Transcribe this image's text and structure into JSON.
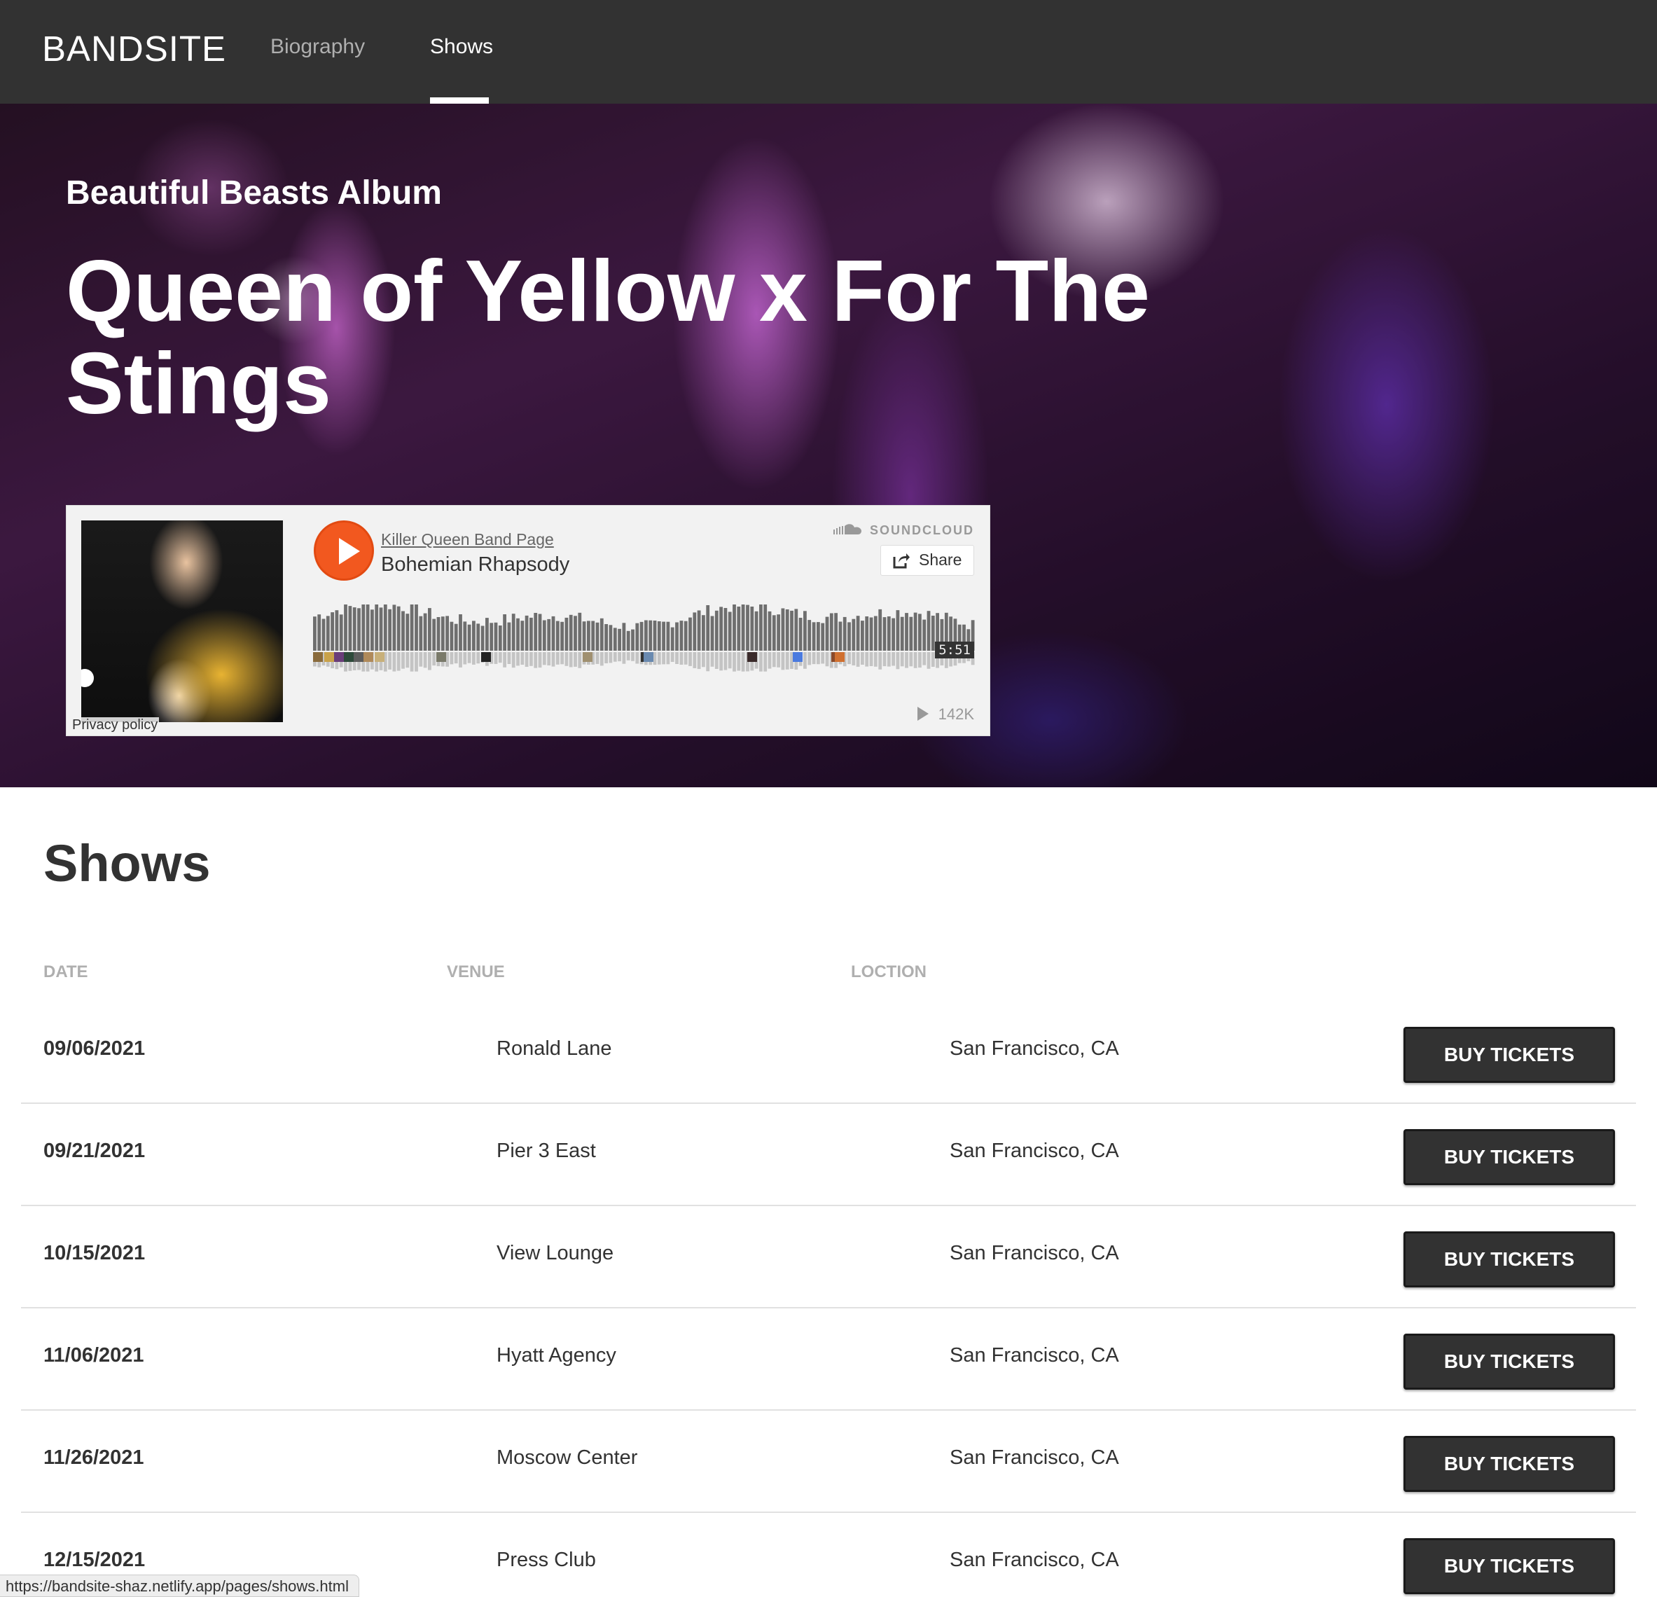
{
  "header": {
    "logo": "BANDSITE",
    "nav": [
      {
        "label": "Biography",
        "active": false
      },
      {
        "label": "Shows",
        "active": true
      }
    ]
  },
  "hero": {
    "subtitle": "Beautiful Beasts Album",
    "title": "Queen of Yellow x For The Stings"
  },
  "player": {
    "artist": "Killer Queen Band Page",
    "track": "Bohemian Rhapsody",
    "brand": "SOUNDCLOUD",
    "share_label": "Share",
    "duration": "5:51",
    "plays": "142K",
    "privacy": "Privacy policy",
    "accent_color": "#f2581f"
  },
  "shows": {
    "title": "Shows",
    "columns": {
      "date": "DATE",
      "venue": "VENUE",
      "location": "LOCTION"
    },
    "button_label": "BUY TICKETS",
    "rows": [
      {
        "date": "09/06/2021",
        "venue": "Ronald Lane",
        "location": "San Francisco, CA"
      },
      {
        "date": "09/21/2021",
        "venue": "Pier 3 East",
        "location": "San Francisco, CA"
      },
      {
        "date": "10/15/2021",
        "venue": "View Lounge",
        "location": "San Francisco, CA"
      },
      {
        "date": "11/06/2021",
        "venue": "Hyatt Agency",
        "location": "San Francisco, CA"
      },
      {
        "date": "11/26/2021",
        "venue": "Moscow Center",
        "location": "San Francisco, CA"
      },
      {
        "date": "12/15/2021",
        "venue": "Press Club",
        "location": "San Francisco, CA"
      }
    ]
  },
  "status_bar": {
    "url": "https://bandsite-shaz.netlify.app/pages/shows.html"
  },
  "icons": [
    "soundcloud-logo-icon",
    "share-icon",
    "play-icon",
    "plays-count-icon"
  ]
}
